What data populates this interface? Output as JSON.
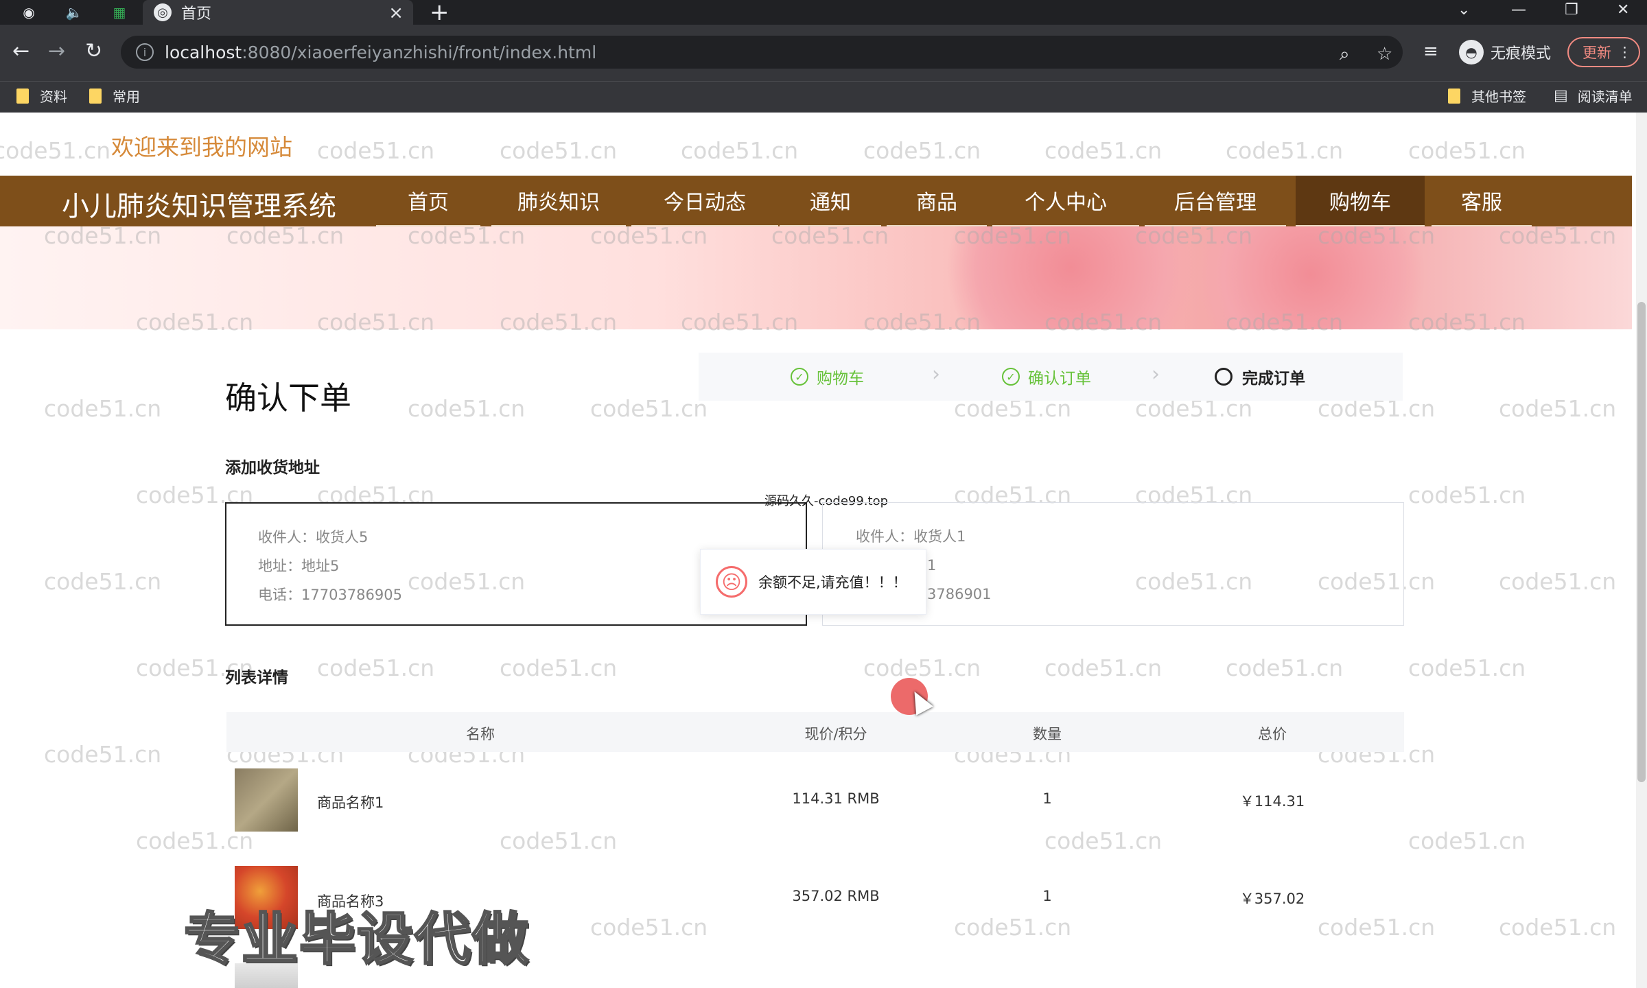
{
  "browser": {
    "tab_title": "首页",
    "url_host": "localhost",
    "url_path": ":8080/xiaoerfeiyanzhishi/front/index.html",
    "incognito_label": "无痕模式",
    "update_label": "更新",
    "bookmarks": [
      "资料",
      "常用"
    ],
    "other_bookmarks": "其他书签",
    "reading_list": "阅读清单"
  },
  "site": {
    "welcome": "欢迎来到我的网站",
    "brand": "小儿肺炎知识管理系统",
    "nav": [
      "首页",
      "肺炎知识",
      "今日动态",
      "通知",
      "商品",
      "个人中心",
      "后台管理",
      "购物车",
      "客服"
    ],
    "active_nav": "购物车"
  },
  "watermark": "code51.cn",
  "checkout": {
    "title": "确认下单",
    "steps": [
      "购物车",
      "确认订单",
      "完成订单"
    ],
    "address_section": "添加收货地址",
    "source_tip": "源码久久-code99.top",
    "addresses": [
      {
        "recipient": "收件人：收货人5",
        "address": "地址：地址5",
        "phone": "电话：17703786905"
      },
      {
        "recipient": "收件人：收货人1",
        "address": "1",
        "phone": "3786901"
      }
    ],
    "toast": "余额不足,请充值！！！",
    "list_section": "列表详情",
    "table_headers": [
      "名称",
      "现价/积分",
      "数量",
      "总价"
    ],
    "items": [
      {
        "name": "商品名称1",
        "price": "114.31 RMB",
        "qty": "1",
        "total": "￥114.31"
      },
      {
        "name": "商品名称3",
        "price": "357.02 RMB",
        "qty": "1",
        "total": "￥357.02"
      }
    ]
  },
  "promo": "专业毕设代做"
}
